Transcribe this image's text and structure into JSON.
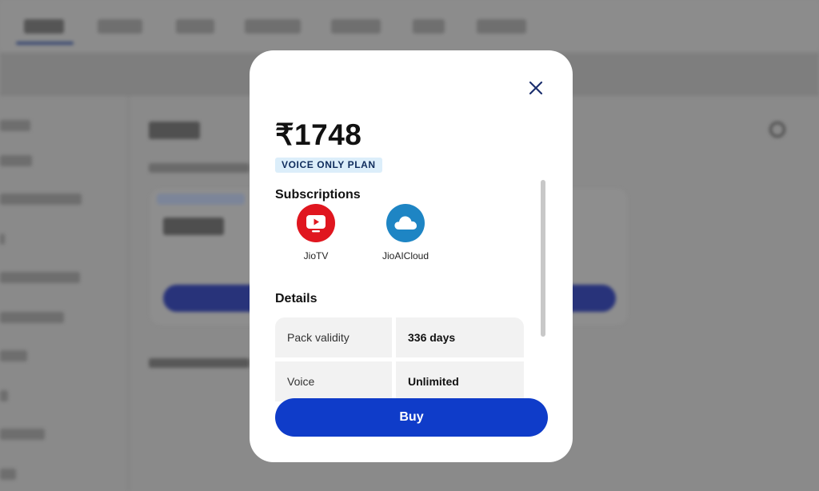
{
  "modal": {
    "price": "₹1748",
    "plan_badge": "VOICE ONLY PLAN",
    "subscriptions_title": "Subscriptions",
    "subscriptions": [
      {
        "label": "JioTV",
        "icon": "tv-play-icon",
        "color": "#e0161f"
      },
      {
        "label": "JioAICloud",
        "icon": "cloud-icon",
        "color": "#1e85c4"
      }
    ],
    "details_title": "Details",
    "details": [
      {
        "key": "Pack validity",
        "value": "336 days"
      },
      {
        "key": "Voice",
        "value": "Unlimited"
      }
    ],
    "buy_label": "Buy",
    "close_icon": "close-icon"
  },
  "colors": {
    "accent": "#0f3cc9",
    "badge_bg": "#dceefa",
    "overlay": "#8a8a8a"
  }
}
